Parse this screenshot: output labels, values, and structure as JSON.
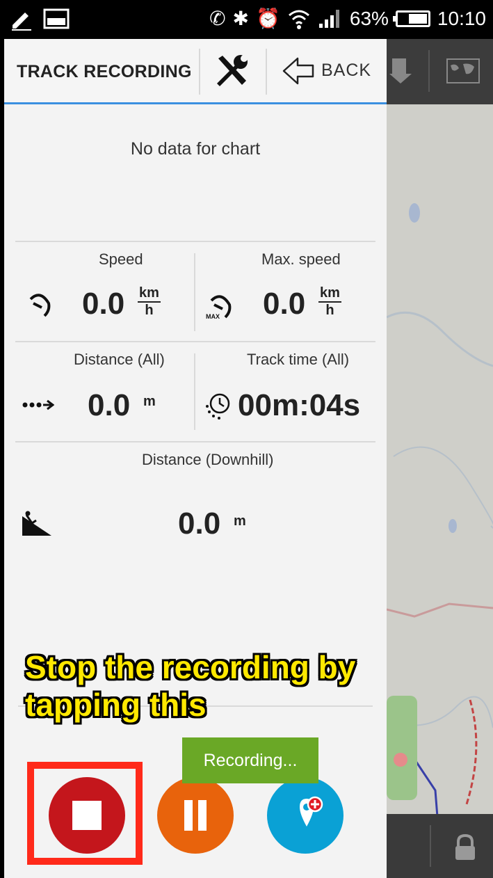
{
  "status_bar": {
    "battery_percent": "63%",
    "time": "10:10",
    "icons": [
      "edit-icon",
      "screen-icon",
      "nfc-icon",
      "bluetooth-icon",
      "alarm-icon",
      "wifi-icon",
      "signal-icon",
      "battery-icon"
    ]
  },
  "header": {
    "title": "TRACK RECORDING",
    "back_label": "BACK"
  },
  "chart": {
    "empty_message": "No data for chart"
  },
  "stats": {
    "speed": {
      "label": "Speed",
      "value": "0.0",
      "unit_num": "km",
      "unit_den": "h"
    },
    "max_speed": {
      "label": "Max. speed",
      "value": "0.0",
      "unit_num": "km",
      "unit_den": "h"
    },
    "distance_all": {
      "label": "Distance (All)",
      "value": "0.0",
      "unit": "m"
    },
    "track_time_all": {
      "label": "Track time (All)",
      "value": "00m:04s"
    },
    "distance_downhill": {
      "label": "Distance (Downhill)",
      "value": "0.0",
      "unit": "m"
    }
  },
  "overlay": {
    "caption_line1": "Stop the recording by",
    "caption_line2": "tapping this",
    "toast": "Recording..."
  },
  "colors": {
    "accent_blue": "#3b8fe0",
    "stop_red": "#c4161c",
    "pause_orange": "#e8630c",
    "poi_blue": "#0aa1d5",
    "highlight_red": "#ff2a1a",
    "toast_green": "#6aa826",
    "caption_yellow": "#ffe800"
  }
}
